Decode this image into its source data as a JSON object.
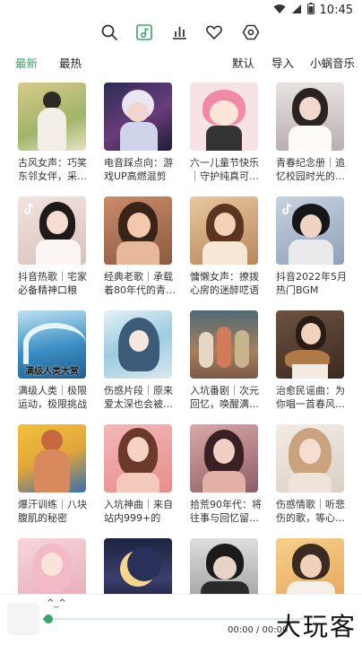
{
  "status_bar": {
    "time": "10:45"
  },
  "top_nav": {
    "icons": [
      "search-icon",
      "music-library-icon",
      "bar-chart-icon",
      "heart-icon",
      "settings-hex-icon"
    ],
    "active_color": "#3aa56a"
  },
  "filter_bar": {
    "left_tabs": [
      "最新",
      "最热"
    ],
    "right_tabs": [
      "默认",
      "导入",
      "小蜗音乐"
    ],
    "active": "最新"
  },
  "playlists": [
    {
      "title": "古风女声：巧笑东邻女伴，采…"
    },
    {
      "title": "电音踩点向：游戏UP高燃混剪"
    },
    {
      "title": "六一儿童节快乐｜守护纯真可…"
    },
    {
      "title": "青春纪念册｜追忆校园时光的…"
    },
    {
      "title": "抖音热歌｜宅家必备精神口粮"
    },
    {
      "title": "经典老歌｜承载着80年代的青…"
    },
    {
      "title": "慵懒女声：撩拨心房的迷醉呓语"
    },
    {
      "title": "抖音2022年5月热门BGM"
    },
    {
      "title": "满级人类｜极限运动，极限挑战",
      "cover_text": "满级人类大赏"
    },
    {
      "title": "伤感片段｜原来爱太深也会被…"
    },
    {
      "title": "入坑番剧｜次元回忆，唤醒满…"
    },
    {
      "title": "治愈民谣曲：为你唱一首春风…"
    },
    {
      "title": "爆汗训练｜八块腹肌的秘密"
    },
    {
      "title": "入坑神曲｜来自站内999+的破…"
    },
    {
      "title": "拾荒90年代：将往事与回忆留…"
    },
    {
      "title": "伤感情歌｜听悲伤的歌，等心…"
    },
    {
      "title": ""
    },
    {
      "title": ""
    },
    {
      "title": ""
    },
    {
      "title": ""
    }
  ],
  "player": {
    "song": "^_^",
    "time": "00:00 / 00:00",
    "progress": 0.02
  },
  "watermark": "大玩客"
}
